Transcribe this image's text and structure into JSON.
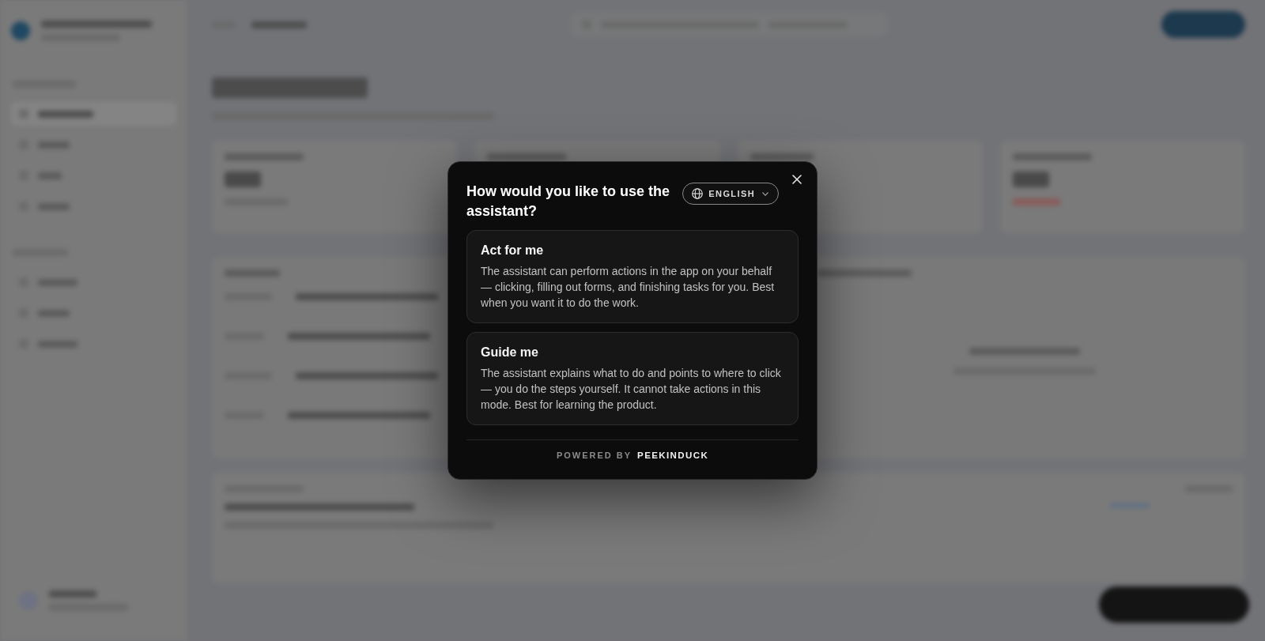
{
  "dialog": {
    "title": "How would you like to use the assistant?",
    "language_button": {
      "label": "ENGLISH"
    },
    "options": [
      {
        "title": "Act for me",
        "description": "The assistant can perform actions in the app on your behalf — clicking, filling out forms, and finishing tasks for you. Best when you want it to do the work."
      },
      {
        "title": "Guide me",
        "description": "The assistant explains what to do and points to where to click — you do the steps yourself. It cannot take actions in this mode. Best for learning the product."
      }
    ],
    "footer": {
      "prefix": "POWERED BY",
      "brand": "PEEKINDUCK"
    }
  }
}
